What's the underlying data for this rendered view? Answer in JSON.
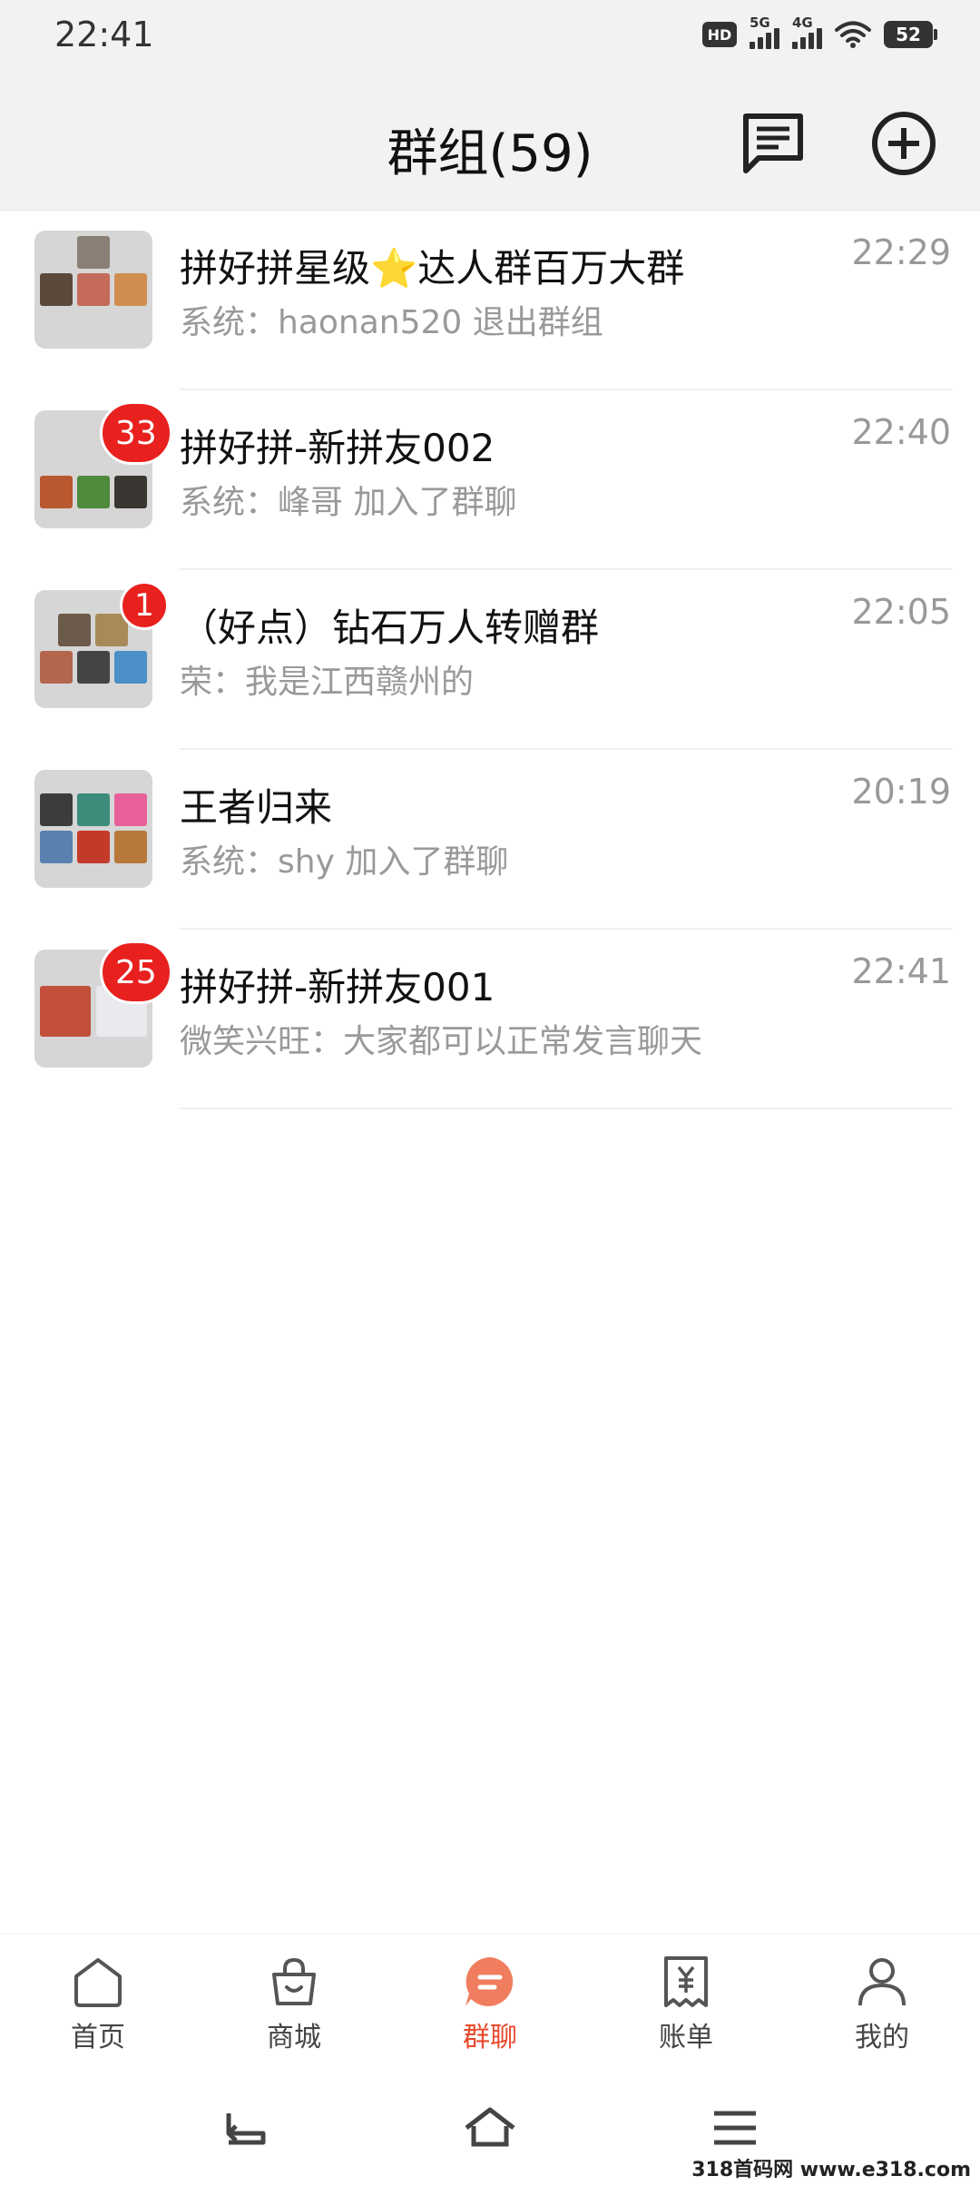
{
  "status_bar": {
    "time": "22:41",
    "hd_label": "HD",
    "sim1_label": "5G",
    "sim2_label": "4G",
    "battery": "52"
  },
  "header": {
    "title": "群组(59)",
    "message_icon": "chat-bubble-icon",
    "add_icon": "plus-circle-icon"
  },
  "groups": [
    {
      "name": "拼好拼星级⭐达人群百万大群",
      "time": "22:29",
      "last_message": "系统：haonan520 退出群组",
      "unread": ""
    },
    {
      "name": "拼好拼-新拼友002",
      "time": "22:40",
      "last_message": "系统：峰哥 加入了群聊",
      "unread": "33"
    },
    {
      "name": "（好点）钻石万人转赠群",
      "time": "22:05",
      "last_message": "荣：我是江西赣州的",
      "unread": "1"
    },
    {
      "name": "王者归来",
      "time": "20:19",
      "last_message": "系统：shy 加入了群聊",
      "unread": ""
    },
    {
      "name": "拼好拼-新拼友001",
      "time": "22:41",
      "last_message": "微笑兴旺：大家都可以正常发言聊天",
      "unread": "25"
    }
  ],
  "tabs": [
    {
      "label": "首页",
      "icon": "home-icon"
    },
    {
      "label": "商城",
      "icon": "shopping-bag-icon"
    },
    {
      "label": "群聊",
      "icon": "chat-icon",
      "active": true
    },
    {
      "label": "账单",
      "icon": "bill-icon"
    },
    {
      "label": "我的",
      "icon": "profile-icon"
    }
  ],
  "nav": {
    "back_icon": "back-icon",
    "home_icon": "home-outline-icon",
    "menu_icon": "menu-icon"
  },
  "watermark": "318首码网 www.e318.com",
  "colors": {
    "accent": "#e8492b",
    "badge": "#e8201e",
    "header_bg": "#f2f2f2"
  }
}
